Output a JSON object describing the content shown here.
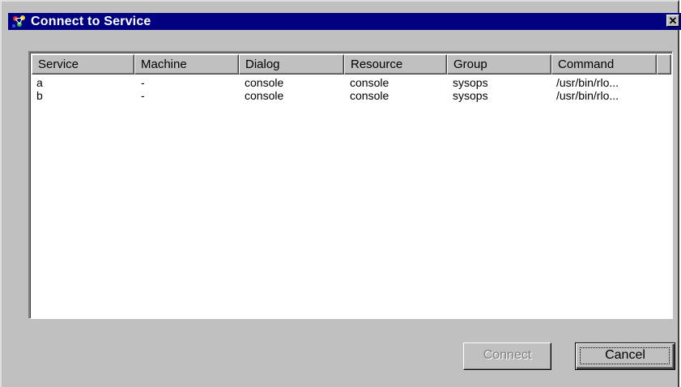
{
  "window": {
    "title": "Connect to Service",
    "close_label": "✕"
  },
  "list": {
    "columns": [
      {
        "label": "Service"
      },
      {
        "label": "Machine"
      },
      {
        "label": "Dialog"
      },
      {
        "label": "Resource"
      },
      {
        "label": "Group"
      },
      {
        "label": "Command"
      }
    ],
    "rows": [
      {
        "service": "a",
        "machine": "-",
        "dialog": "console",
        "resource": "console",
        "group": "sysops",
        "command": "/usr/bin/rlo..."
      },
      {
        "service": "b",
        "machine": "-",
        "dialog": "console",
        "resource": "console",
        "group": "sysops",
        "command": "/usr/bin/rlo..."
      }
    ]
  },
  "buttons": {
    "connect_label": "Connect",
    "connect_enabled": false,
    "cancel_label": "Cancel"
  },
  "colors": {
    "titlebar": "#000080",
    "face": "#c0c0c0",
    "disabled_text": "#808080"
  },
  "icons": {
    "app": "network-app-icon",
    "close": "close-icon"
  }
}
